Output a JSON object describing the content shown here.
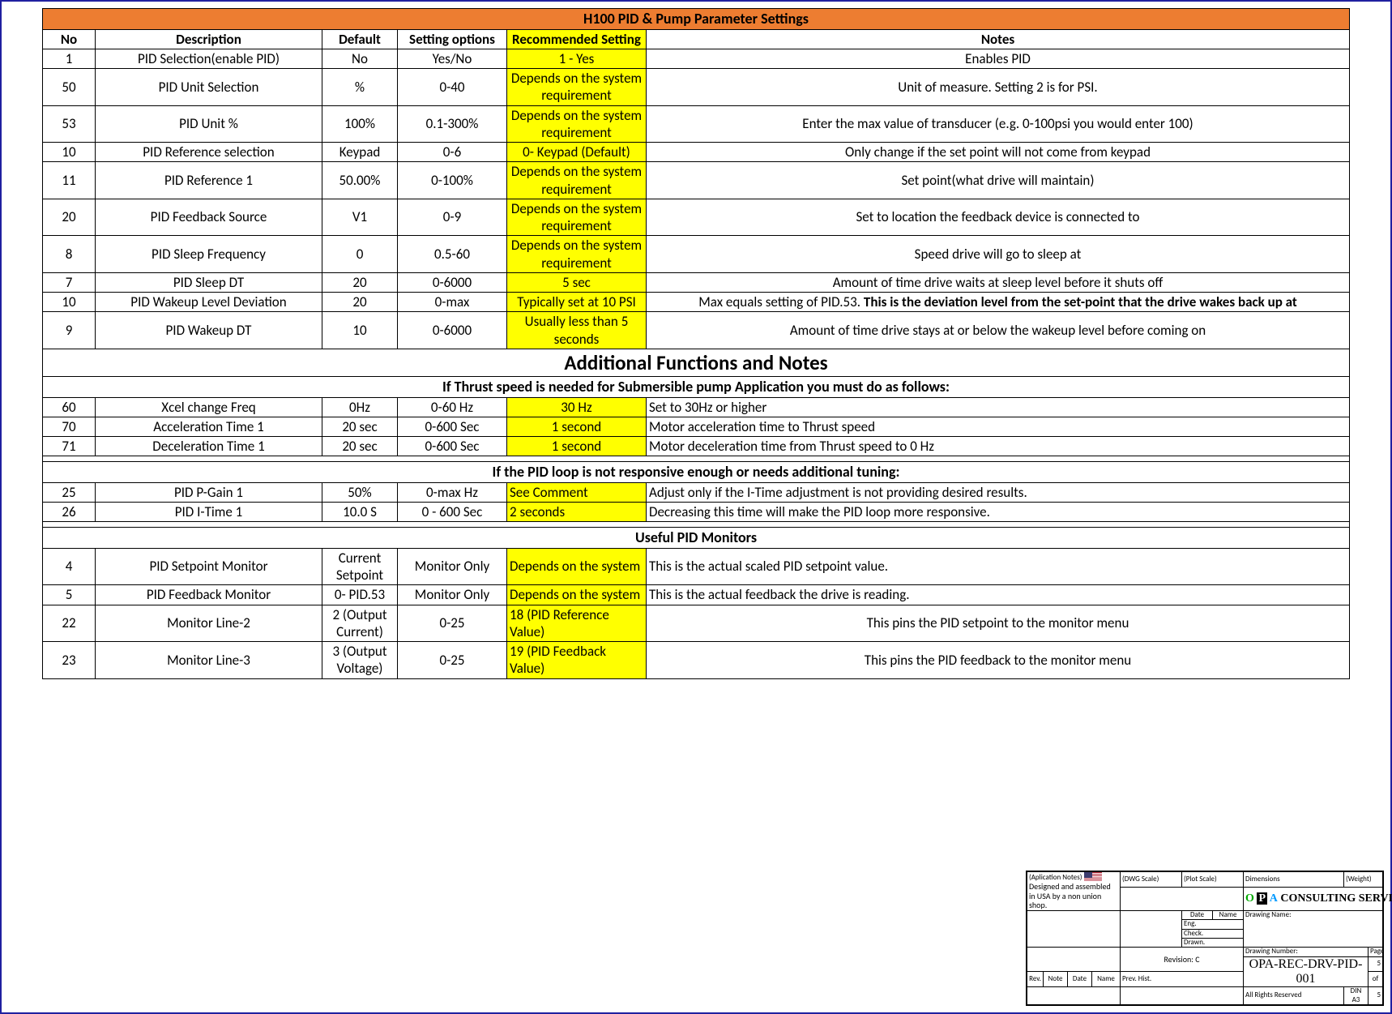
{
  "title": "H100 PID & Pump Parameter Settings",
  "cols": {
    "no": "No",
    "desc": "Description",
    "def": "Default",
    "opt": "Setting options",
    "rec": "Recommended Setting",
    "notes": "Notes"
  },
  "rows1": [
    {
      "no": "1",
      "desc": "PID Selection(enable PID)",
      "def": "No",
      "opt": "Yes/No",
      "rec": "1 - Yes",
      "notes": "Enables PID"
    },
    {
      "no": "50",
      "desc": "PID Unit Selection",
      "def": "%",
      "opt": "0-40",
      "rec": "Depends on the system requirement",
      "notes": "Unit of measure. Setting 2 is for PSI."
    },
    {
      "no": "53",
      "desc": "PID Unit %",
      "def": "100%",
      "opt": "0.1-300%",
      "rec": "Depends on the system requirement",
      "notes": "Enter the max value of transducer (e.g. 0-100psi you would enter 100)"
    },
    {
      "no": "10",
      "desc": "PID Reference selection",
      "def": "Keypad",
      "opt": "0-6",
      "rec": "0- Keypad (Default)",
      "notes": "Only change if the set point will not come from keypad"
    },
    {
      "no": "11",
      "desc": "PID Reference 1",
      "def": "50.00%",
      "opt": "0-100%",
      "rec": "Depends on the system requirement",
      "notes": "Set point(what drive will maintain)"
    },
    {
      "no": "20",
      "desc": "PID Feedback Source",
      "def": "V1",
      "opt": "0-9",
      "rec": "Depends on the system requirement",
      "notes": "Set to location the feedback device is connected to"
    },
    {
      "no": "8",
      "desc": "PID Sleep Frequency",
      "def": "0",
      "opt": "0.5-60",
      "rec": "Depends on the system requirement",
      "notes": "Speed drive will go to sleep at"
    },
    {
      "no": "7",
      "desc": "PID Sleep DT",
      "def": "20",
      "opt": "0-6000",
      "rec": "5 sec",
      "notes": "Amount of time drive waits at sleep level before it shuts off"
    },
    {
      "no": "10",
      "desc": "PID Wakeup Level Deviation",
      "def": "20",
      "opt": "0-max",
      "rec": "Typically set at 10 PSI",
      "notes_pre": "Max equals setting of PID.53. ",
      "notes_bold": "This is the deviation level from the set-point that the drive wakes back up at"
    },
    {
      "no": "9",
      "desc": "PID Wakeup DT",
      "def": "10",
      "opt": "0-6000",
      "rec": "Usually less than 5 seconds",
      "notes": "Amount of time drive stays at or below the wakeup level before coming on"
    }
  ],
  "sec2": {
    "title": "Additional Functions and Notes",
    "sub1": "If Thrust speed is needed for Submersible pump Application you must do as follows:",
    "rows": [
      {
        "no": "60",
        "desc": "Xcel change Freq",
        "def": "0Hz",
        "opt": "0-60 Hz",
        "rec": "30 Hz",
        "notes": "Set to 30Hz or higher",
        "la": "l"
      },
      {
        "no": "70",
        "desc": "Acceleration Time 1",
        "def": "20 sec",
        "opt": "0-600 Sec",
        "rec": "1 second",
        "notes": "Motor acceleration time to Thrust speed",
        "la": "l"
      },
      {
        "no": "71",
        "desc": "Deceleration Time 1",
        "def": "20 sec",
        "opt": "0-600 Sec",
        "rec": "1 second",
        "notes": "Motor deceleration time from Thrust speed to 0 Hz",
        "la": "l"
      }
    ],
    "sub2": "If the PID loop is not responsive enough or needs additional tuning:",
    "rows2": [
      {
        "no": "25",
        "desc": "PID P-Gain 1",
        "def": "50%",
        "opt": "0-max Hz",
        "rec": "See Comment",
        "notes": "Adjust only if the I-Time adjustment is not providing desired results.",
        "la": "l",
        "recl": "l"
      },
      {
        "no": "26",
        "desc": "PID I-Time 1",
        "def": "10.0 S",
        "opt": "0 - 600 Sec",
        "rec": "2 seconds",
        "notes": "Decreasing this time will make the PID loop more responsive.",
        "la": "l",
        "recl": "l"
      }
    ]
  },
  "sec3": {
    "title": "Useful PID Monitors",
    "rows": [
      {
        "no": "4",
        "desc": "PID Setpoint Monitor",
        "def": "Current Setpoint",
        "opt": "Monitor Only",
        "rec": "Depends on the system",
        "notes": "This is the actual scaled PID setpoint value.",
        "la": "l",
        "recl": "l"
      },
      {
        "no": "5",
        "desc": "PID Feedback Monitor",
        "def": "0- PID.53",
        "opt": "Monitor Only",
        "rec": "Depends on the system",
        "notes": "This is the actual feedback the drive is reading.",
        "la": "l",
        "recl": "l"
      },
      {
        "no": "22",
        "desc": "Monitor Line-2",
        "def": "2 (Output Current)",
        "opt": "0-25",
        "rec": "18 (PID Reference Value)",
        "notes": "This pins the PID setpoint to the monitor menu",
        "recl": "l"
      },
      {
        "no": "23",
        "desc": "Monitor Line-3",
        "def": "3 (Output Voltage)",
        "opt": "0-25",
        "rec": "19 (PID Feedback Value)",
        "notes": "This pins the PID feedback to the monitor menu",
        "recl": "l"
      }
    ]
  },
  "tb": {
    "app": "(Aplication Notes)",
    "dwgscale": "(DWG Scale)",
    "plotscale": "(Plot Scale)",
    "dim": "Dimensions",
    "weight": "(Weight)",
    "designed": "Designed and assembled in USA by a non union shop.",
    "company": "CONSULTING SERVICES, INC.",
    "drawingname": "Drawing Name:",
    "date": "Date",
    "name": "Name",
    "eng": "Eng.",
    "check": "Check.",
    "drawn": "Drawn.",
    "rev": "Rev.",
    "note": "Note",
    "prev": "Prev. Hist.",
    "revision": "Revision: C",
    "dwgnumlab": "Drawing Number:",
    "dwgnum": "OPA-REC-DRV-PID-001",
    "rights": "All Rights Reserved",
    "din": "DIN A3",
    "page": "Page",
    "p1": "5",
    "of": "of",
    "p2": "5"
  }
}
